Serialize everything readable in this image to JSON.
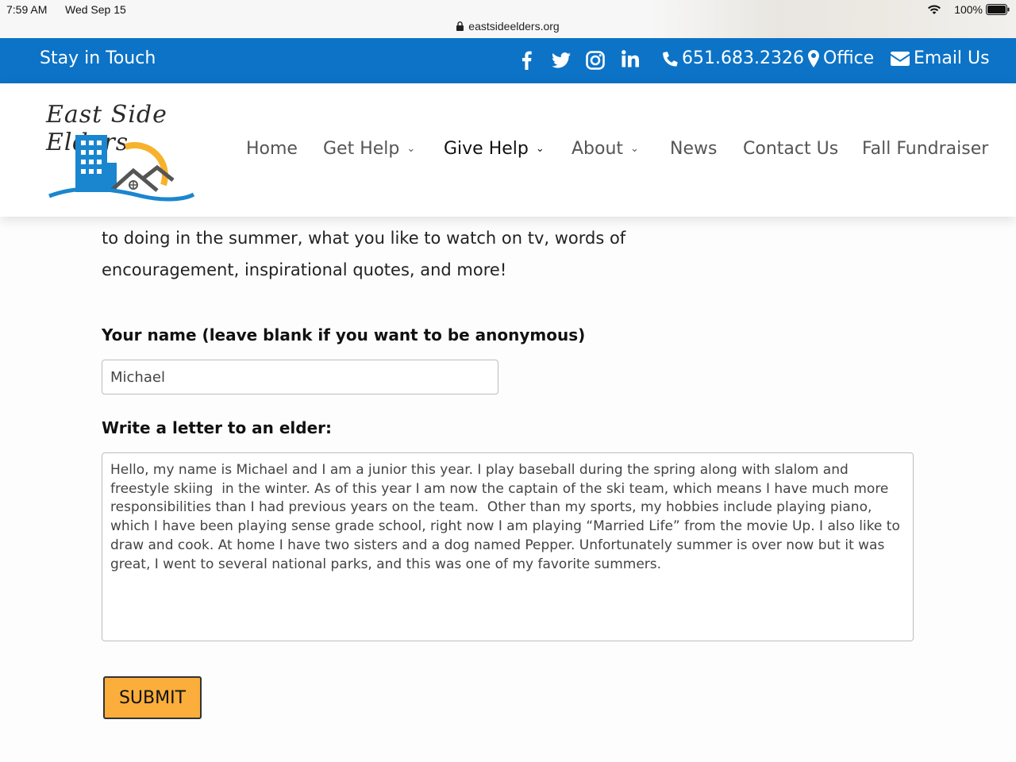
{
  "status_bar": {
    "time": "7:59 AM",
    "date": "Wed Sep 15",
    "battery": "100%",
    "url": "eastsideelders.org"
  },
  "topbar": {
    "stay_in_touch": "Stay in Touch",
    "phone": "651.683.2326",
    "office": "Office",
    "email": "Email Us",
    "social_icons": [
      "facebook-icon",
      "twitter-icon",
      "instagram-icon",
      "linkedin-icon"
    ],
    "color": "#0c73c7"
  },
  "logo": {
    "text": "East Side Elders"
  },
  "nav": {
    "home": "Home",
    "get_help": "Get Help",
    "give_help": "Give Help",
    "about": "About",
    "news": "News",
    "contact": "Contact Us",
    "fundraiser": "Fall Fundraiser"
  },
  "content": {
    "intro_line1": "to doing in the summer, what you like to watch on tv, words of",
    "intro_line2": "encouragement, inspirational quotes, and more!",
    "name_label": "Your name (leave blank if you want to be anonymous)",
    "name_value": "Michael",
    "letter_label": "Write a letter to an elder:",
    "letter_value": "Hello, my name is Michael and I am a junior this year. I play baseball during the spring along with slalom and freestyle skiing  in the winter. As of this year I am now the captain of the ski team, which means I have much more responsibilities than I had previous years on the team.  Other than my sports, my hobbies include playing piano, which I have been playing sense grade school, right now I am playing “Married Life” from the movie Up. I also like to draw and cook. At home I have two sisters and a dog named Pepper. Unfortunately summer is over now but it was great, I went to several national parks, and this was one of my favorite summers.",
    "submit_label": "SUBMIT",
    "submit_color": "#fbae3c"
  }
}
